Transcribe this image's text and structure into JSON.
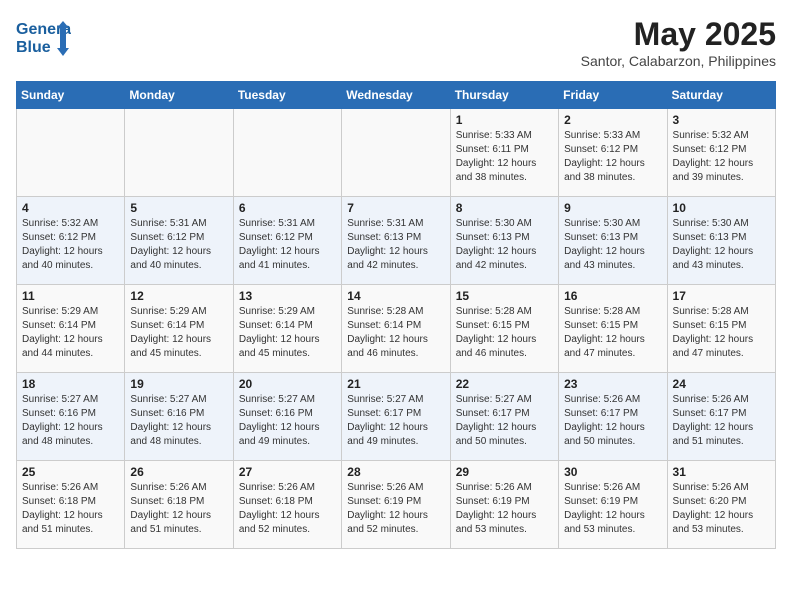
{
  "header": {
    "logo_line1": "General",
    "logo_line2": "Blue",
    "month": "May 2025",
    "location": "Santor, Calabarzon, Philippines"
  },
  "days_of_week": [
    "Sunday",
    "Monday",
    "Tuesday",
    "Wednesday",
    "Thursday",
    "Friday",
    "Saturday"
  ],
  "weeks": [
    [
      {
        "day": "",
        "info": ""
      },
      {
        "day": "",
        "info": ""
      },
      {
        "day": "",
        "info": ""
      },
      {
        "day": "",
        "info": ""
      },
      {
        "day": "1",
        "info": "Sunrise: 5:33 AM\nSunset: 6:11 PM\nDaylight: 12 hours\nand 38 minutes."
      },
      {
        "day": "2",
        "info": "Sunrise: 5:33 AM\nSunset: 6:12 PM\nDaylight: 12 hours\nand 38 minutes."
      },
      {
        "day": "3",
        "info": "Sunrise: 5:32 AM\nSunset: 6:12 PM\nDaylight: 12 hours\nand 39 minutes."
      }
    ],
    [
      {
        "day": "4",
        "info": "Sunrise: 5:32 AM\nSunset: 6:12 PM\nDaylight: 12 hours\nand 40 minutes."
      },
      {
        "day": "5",
        "info": "Sunrise: 5:31 AM\nSunset: 6:12 PM\nDaylight: 12 hours\nand 40 minutes."
      },
      {
        "day": "6",
        "info": "Sunrise: 5:31 AM\nSunset: 6:12 PM\nDaylight: 12 hours\nand 41 minutes."
      },
      {
        "day": "7",
        "info": "Sunrise: 5:31 AM\nSunset: 6:13 PM\nDaylight: 12 hours\nand 42 minutes."
      },
      {
        "day": "8",
        "info": "Sunrise: 5:30 AM\nSunset: 6:13 PM\nDaylight: 12 hours\nand 42 minutes."
      },
      {
        "day": "9",
        "info": "Sunrise: 5:30 AM\nSunset: 6:13 PM\nDaylight: 12 hours\nand 43 minutes."
      },
      {
        "day": "10",
        "info": "Sunrise: 5:30 AM\nSunset: 6:13 PM\nDaylight: 12 hours\nand 43 minutes."
      }
    ],
    [
      {
        "day": "11",
        "info": "Sunrise: 5:29 AM\nSunset: 6:14 PM\nDaylight: 12 hours\nand 44 minutes."
      },
      {
        "day": "12",
        "info": "Sunrise: 5:29 AM\nSunset: 6:14 PM\nDaylight: 12 hours\nand 45 minutes."
      },
      {
        "day": "13",
        "info": "Sunrise: 5:29 AM\nSunset: 6:14 PM\nDaylight: 12 hours\nand 45 minutes."
      },
      {
        "day": "14",
        "info": "Sunrise: 5:28 AM\nSunset: 6:14 PM\nDaylight: 12 hours\nand 46 minutes."
      },
      {
        "day": "15",
        "info": "Sunrise: 5:28 AM\nSunset: 6:15 PM\nDaylight: 12 hours\nand 46 minutes."
      },
      {
        "day": "16",
        "info": "Sunrise: 5:28 AM\nSunset: 6:15 PM\nDaylight: 12 hours\nand 47 minutes."
      },
      {
        "day": "17",
        "info": "Sunrise: 5:28 AM\nSunset: 6:15 PM\nDaylight: 12 hours\nand 47 minutes."
      }
    ],
    [
      {
        "day": "18",
        "info": "Sunrise: 5:27 AM\nSunset: 6:16 PM\nDaylight: 12 hours\nand 48 minutes."
      },
      {
        "day": "19",
        "info": "Sunrise: 5:27 AM\nSunset: 6:16 PM\nDaylight: 12 hours\nand 48 minutes."
      },
      {
        "day": "20",
        "info": "Sunrise: 5:27 AM\nSunset: 6:16 PM\nDaylight: 12 hours\nand 49 minutes."
      },
      {
        "day": "21",
        "info": "Sunrise: 5:27 AM\nSunset: 6:17 PM\nDaylight: 12 hours\nand 49 minutes."
      },
      {
        "day": "22",
        "info": "Sunrise: 5:27 AM\nSunset: 6:17 PM\nDaylight: 12 hours\nand 50 minutes."
      },
      {
        "day": "23",
        "info": "Sunrise: 5:26 AM\nSunset: 6:17 PM\nDaylight: 12 hours\nand 50 minutes."
      },
      {
        "day": "24",
        "info": "Sunrise: 5:26 AM\nSunset: 6:17 PM\nDaylight: 12 hours\nand 51 minutes."
      }
    ],
    [
      {
        "day": "25",
        "info": "Sunrise: 5:26 AM\nSunset: 6:18 PM\nDaylight: 12 hours\nand 51 minutes."
      },
      {
        "day": "26",
        "info": "Sunrise: 5:26 AM\nSunset: 6:18 PM\nDaylight: 12 hours\nand 51 minutes."
      },
      {
        "day": "27",
        "info": "Sunrise: 5:26 AM\nSunset: 6:18 PM\nDaylight: 12 hours\nand 52 minutes."
      },
      {
        "day": "28",
        "info": "Sunrise: 5:26 AM\nSunset: 6:19 PM\nDaylight: 12 hours\nand 52 minutes."
      },
      {
        "day": "29",
        "info": "Sunrise: 5:26 AM\nSunset: 6:19 PM\nDaylight: 12 hours\nand 53 minutes."
      },
      {
        "day": "30",
        "info": "Sunrise: 5:26 AM\nSunset: 6:19 PM\nDaylight: 12 hours\nand 53 minutes."
      },
      {
        "day": "31",
        "info": "Sunrise: 5:26 AM\nSunset: 6:20 PM\nDaylight: 12 hours\nand 53 minutes."
      }
    ]
  ]
}
